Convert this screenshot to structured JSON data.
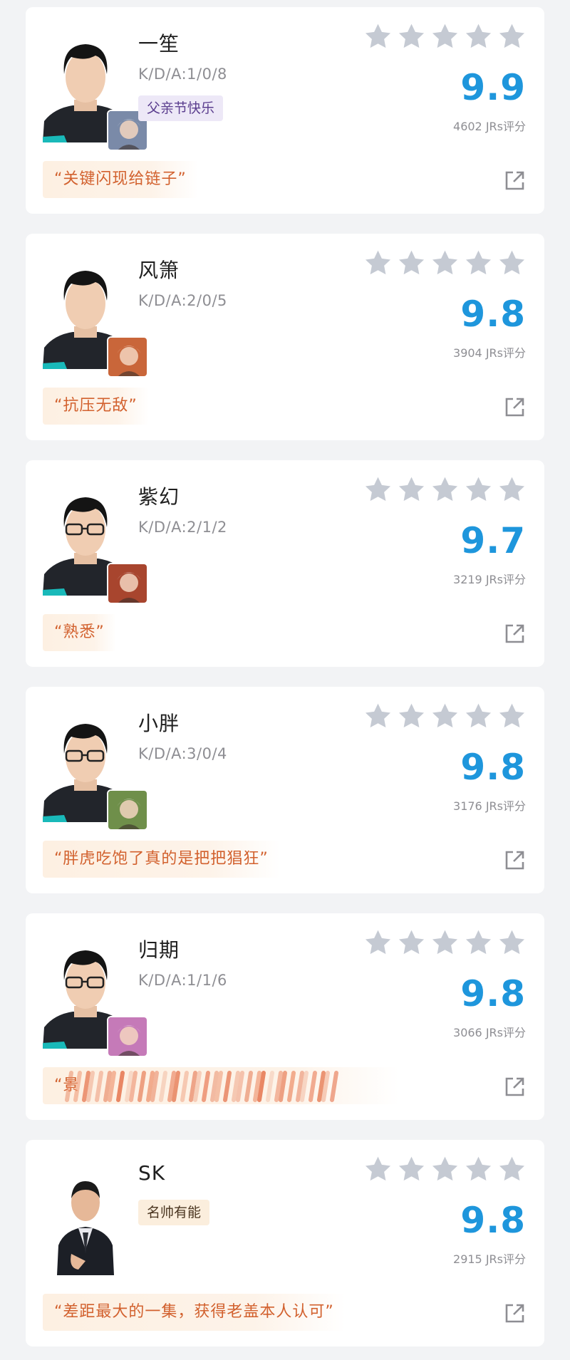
{
  "cards": [
    {
      "name": "一笙",
      "kda": "K/D/A:1/0/8",
      "tag": "父亲节快乐",
      "tag_style": "purple",
      "score": "9.9",
      "votes": "4602 JRs评分",
      "comment": "“关键闪现给链子”",
      "hero_color": "#7a8aa8",
      "glasses": false
    },
    {
      "name": "风箫",
      "kda": "K/D/A:2/0/5",
      "tag": "",
      "score": "9.8",
      "votes": "3904 JRs评分",
      "comment": "“抗压无敌”",
      "hero_color": "#c9663a",
      "glasses": false
    },
    {
      "name": "紫幻",
      "kda": "K/D/A:2/1/2",
      "tag": "",
      "score": "9.7",
      "votes": "3219 JRs评分",
      "comment": "“熟悉”",
      "hero_color": "#a8452e",
      "glasses": true
    },
    {
      "name": "小胖",
      "kda": "K/D/A:3/0/4",
      "tag": "",
      "score": "9.8",
      "votes": "3176 JRs评分",
      "comment": "“胖虎吃饱了真的是把把猖狂”",
      "hero_color": "#6f8f4a",
      "glasses": true
    },
    {
      "name": "归期",
      "kda": "K/D/A:1/1/6",
      "tag": "",
      "score": "9.8",
      "votes": "3066 JRs评分",
      "comment": "“景",
      "redacted": true,
      "hero_color": "#c57ab8",
      "glasses": true
    },
    {
      "name": "SK",
      "kda": "",
      "tag": "名帅有能",
      "tag_style": "orange",
      "score": "9.8",
      "votes": "2915 JRs评分",
      "comment": "“差距最大的一集，获得老盖本人认可”",
      "hero_color": "",
      "glasses": false,
      "coach": true
    }
  ],
  "colors": {
    "score": "#1e96dc",
    "star": "#c5cad3",
    "comment_text": "#d2612e",
    "comment_bg": "#fdf0e2"
  }
}
